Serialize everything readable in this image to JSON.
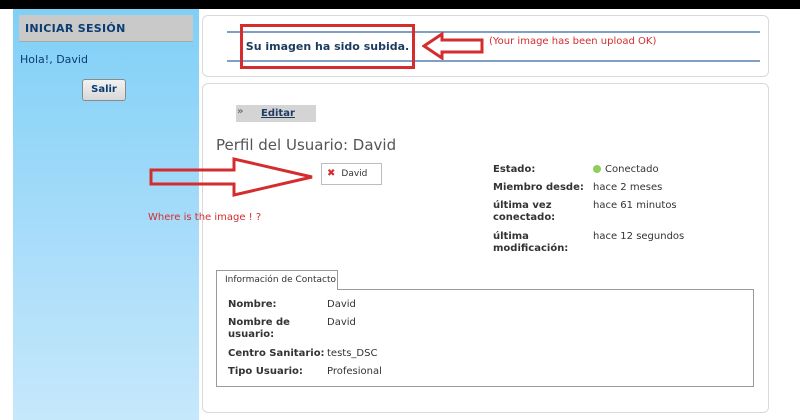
{
  "sidebar": {
    "title": "INICIAR SESIÓN",
    "greeting": "Hola!, David",
    "logout_label": "Salir"
  },
  "notice": {
    "message": "Su imagen ha sido subida.",
    "annotation": "(Your image has been upload OK)"
  },
  "profile": {
    "edit_label": "Editar",
    "edit_icon": "double-chevron-icon",
    "title": "Perfil del Usuario: David",
    "image_alt": "David",
    "broken_image_icon": "broken-image-icon",
    "annotation": "Where is the image ! ?",
    "status_label": "Estado:",
    "status_value": "Conectado",
    "member_since_label": "Miembro desde:",
    "member_since_value": "hace 2 meses",
    "last_connected_label_1": "última vez",
    "last_connected_label_2": "conectado:",
    "last_connected_value": "hace 61 minutos",
    "last_modified_label_1": "última",
    "last_modified_label_2": "modificación:",
    "last_modified_value": "hace 12 segundos"
  },
  "contact": {
    "tab_label": "Información de Contacto",
    "name_label": "Nombre:",
    "name_value": "David",
    "username_label_1": "Nombre de",
    "username_label_2": "usuario:",
    "username_value": "David",
    "center_label": "Centro Sanitario:",
    "center_value": "tests_DSC",
    "type_label": "Tipo Usuario:",
    "type_value": "Profesional"
  },
  "colors": {
    "annotation_red": "#d32d2d",
    "sidebar_blue": "#7fd0f6",
    "connected_green": "#5aa533"
  }
}
